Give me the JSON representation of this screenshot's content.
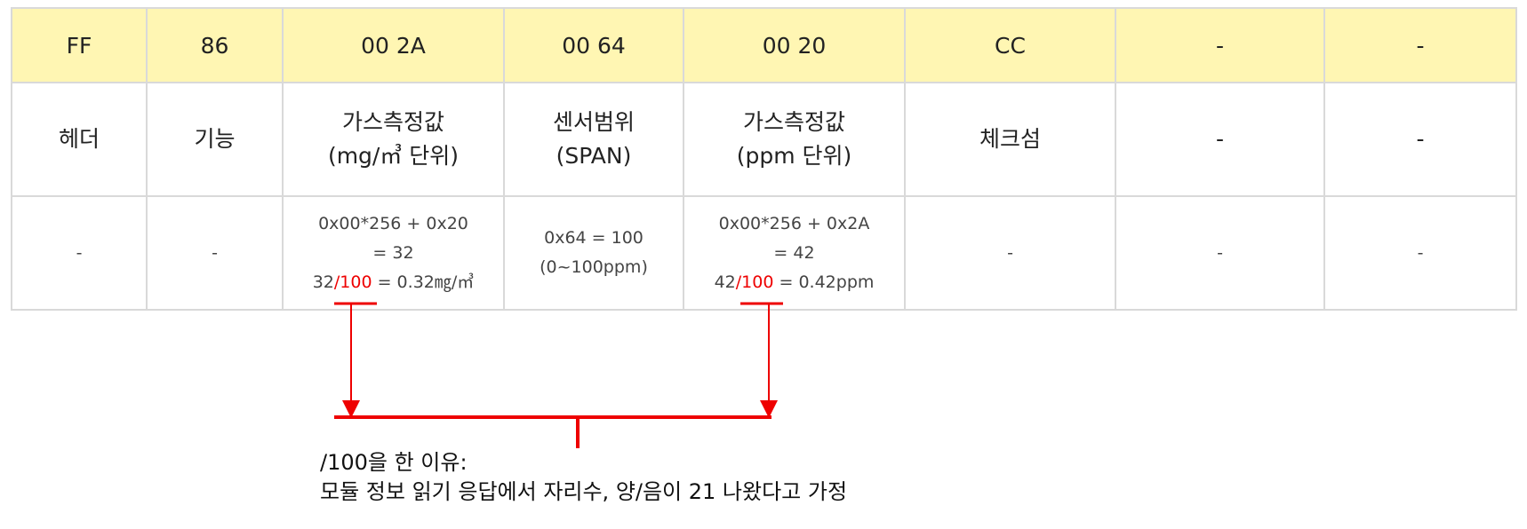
{
  "header_row": [
    "FF",
    "86",
    "00 2A",
    "00 64",
    "00 20",
    "CC",
    "-",
    "-"
  ],
  "desc_row": [
    {
      "lines": [
        "헤더"
      ]
    },
    {
      "lines": [
        "기능"
      ]
    },
    {
      "lines": [
        "가스측정값",
        "(mg/㎥ 단위)"
      ]
    },
    {
      "lines": [
        "센서범위",
        "(SPAN)"
      ]
    },
    {
      "lines": [
        "가스측정값",
        "(ppm 단위)"
      ]
    },
    {
      "lines": [
        "체크섬"
      ]
    },
    {
      "lines": [
        "-"
      ]
    },
    {
      "lines": [
        "-"
      ]
    }
  ],
  "calc_row": {
    "c0": "-",
    "c1": "-",
    "c2": {
      "line1": "0x00*256 + 0x20",
      "line2": "= 32",
      "line3_pre": "32",
      "line3_red": "/100",
      "line3_post": " = 0.32㎎/㎥"
    },
    "c3": {
      "line1": "0x64 = 100",
      "line2": "(0~100ppm)"
    },
    "c4": {
      "line1": "0x00*256 + 0x2A",
      "line2": "= 42",
      "line3_pre": "42",
      "line3_red": "/100",
      "line3_post": " = 0.42ppm"
    },
    "c5": "-",
    "c6": "-",
    "c7": "-"
  },
  "note": {
    "line1": "/100을 한 이유:",
    "line2": "모듈 정보 읽기 응답에서 자리수, 양/음이 21 나왔다고 가정"
  },
  "colors": {
    "header_bg": "#fff6b3",
    "border": "#d9d9d9",
    "annotation": "#ee0000"
  }
}
